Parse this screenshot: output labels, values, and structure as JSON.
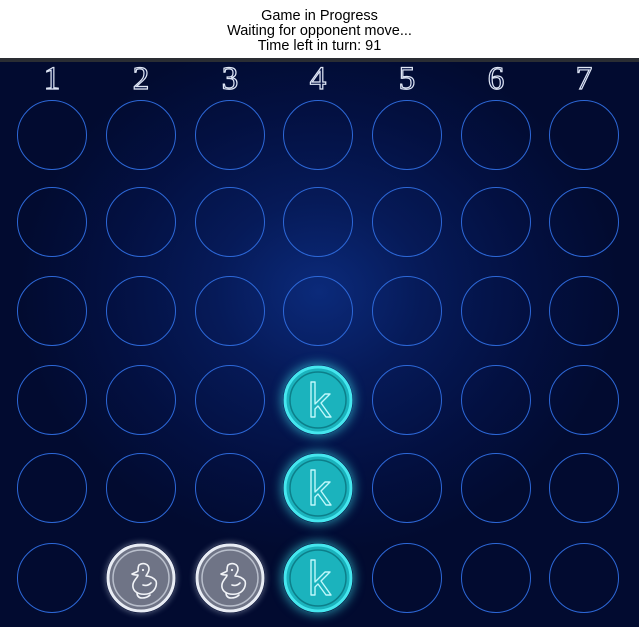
{
  "header": {
    "status_title": "Game in Progress",
    "status_message": "Waiting for opponent move...",
    "turn_timer": "Time left in turn: 91"
  },
  "board": {
    "columns": [
      "1",
      "2",
      "3",
      "4",
      "5",
      "6",
      "7"
    ],
    "rows": 6,
    "cells": [
      [
        "",
        "",
        "",
        "",
        "",
        "",
        ""
      ],
      [
        "",
        "",
        "",
        "",
        "",
        "",
        ""
      ],
      [
        "",
        "",
        "",
        "",
        "",
        "",
        ""
      ],
      [
        "",
        "",
        "",
        "k",
        "",
        "",
        ""
      ],
      [
        "",
        "",
        "",
        "k",
        "",
        "",
        ""
      ],
      [
        "",
        "duck",
        "duck",
        "k",
        "",
        "",
        ""
      ]
    ],
    "pieces": {
      "k": {
        "icon": "k-letter-icon",
        "glyph": "k",
        "fill": "#1bb3bd",
        "ring": "#45e6ee",
        "stroke": "#bff8fb"
      },
      "duck": {
        "icon": "duck-icon",
        "fill": "#6f7486",
        "ring": "#e8ecf4",
        "stroke": "#f2f4f8"
      }
    },
    "colors": {
      "slot_outline": "#2d68d8",
      "background": "#031041"
    }
  }
}
